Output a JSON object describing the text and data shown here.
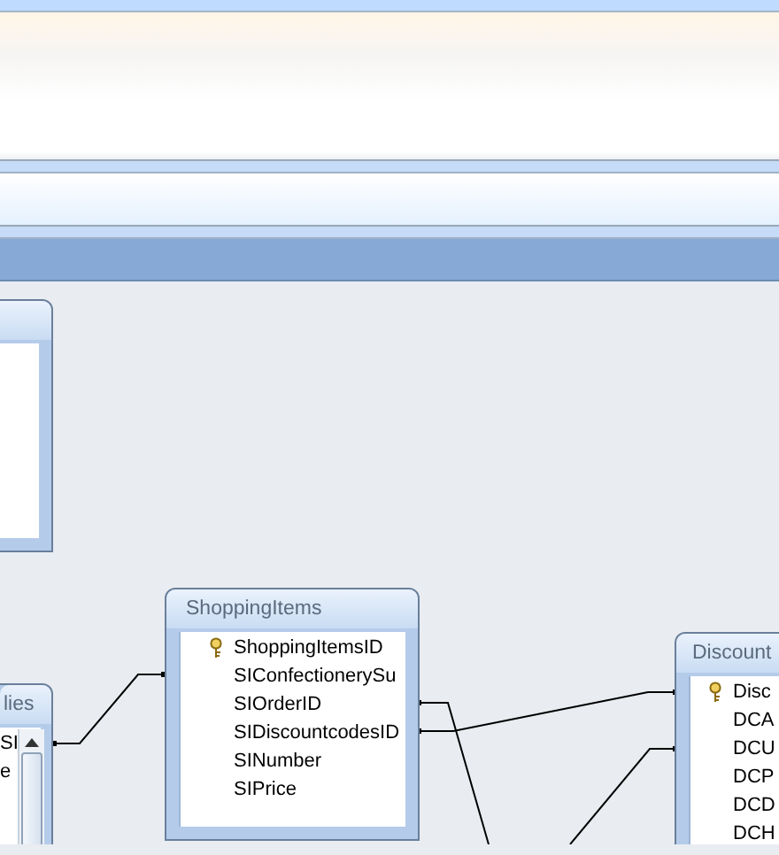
{
  "tables": [
    {
      "title": "ShoppingItems",
      "fields": [
        {
          "name": "ShoppingItemsID",
          "primary_key": true
        },
        {
          "name": "SIConfectionerySu",
          "primary_key": false
        },
        {
          "name": "SIOrderID",
          "primary_key": false
        },
        {
          "name": "SIDiscountcodesID",
          "primary_key": false
        },
        {
          "name": "SINumber",
          "primary_key": false
        },
        {
          "name": "SIPrice",
          "primary_key": false
        }
      ]
    },
    {
      "title": "lies",
      "fields": [
        {
          "name": "SI",
          "primary_key": false
        },
        {
          "name": "e",
          "primary_key": false
        }
      ]
    },
    {
      "title": "Discount",
      "fields": [
        {
          "name": "Disc",
          "primary_key": true
        },
        {
          "name": "DCA",
          "primary_key": false
        },
        {
          "name": "DCU",
          "primary_key": false
        },
        {
          "name": "DCP",
          "primary_key": false
        },
        {
          "name": "DCD",
          "primary_key": false
        },
        {
          "name": "DCH",
          "primary_key": false
        }
      ]
    }
  ]
}
